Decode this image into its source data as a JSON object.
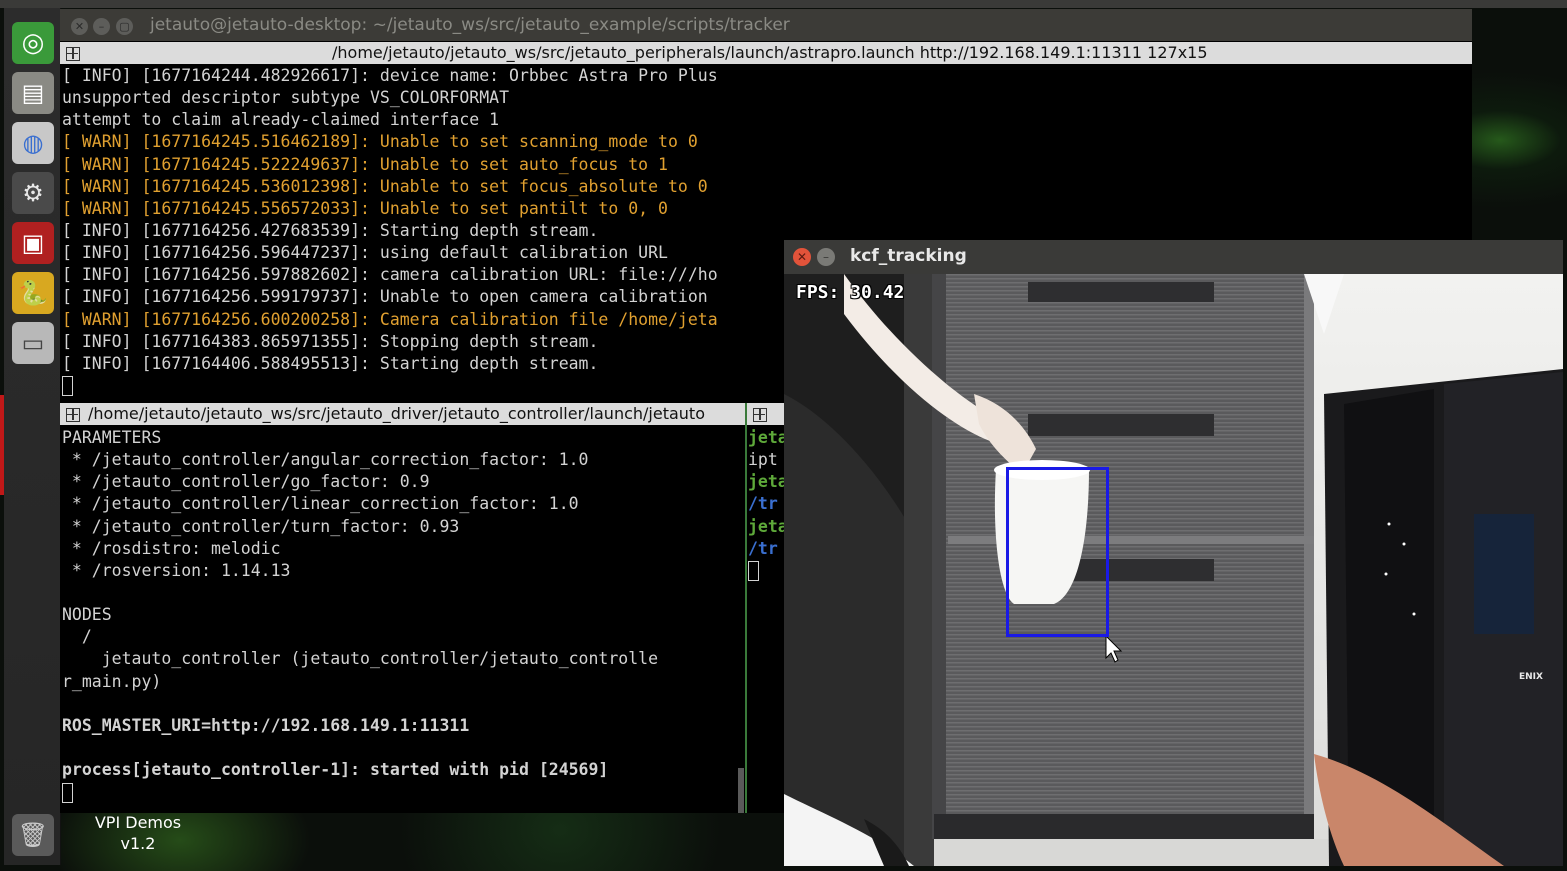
{
  "desktop": {
    "label_title": "VPI Demos",
    "label_version": "v1.2"
  },
  "launcher": {
    "items": [
      {
        "name": "ubuntu-dash",
        "glyph": "◎",
        "color": "#3a9a3a"
      },
      {
        "name": "files",
        "glyph": "▤",
        "color": "#8a8a84"
      },
      {
        "name": "archive-manager",
        "glyph": "◍",
        "color": "#c8c8c8"
      },
      {
        "name": "system-settings",
        "glyph": "⚙",
        "color": "#4a4a4a"
      },
      {
        "name": "monitor-app",
        "glyph": "▣",
        "color": "#b02020"
      },
      {
        "name": "python",
        "glyph": "🐍",
        "color": "#d8a820"
      },
      {
        "name": "drive",
        "glyph": "▭",
        "color": "#b8b8b8"
      },
      {
        "name": "trash",
        "glyph": "🗑",
        "color": "#5a5a5a"
      }
    ]
  },
  "terminal_main": {
    "window_title": "jetauto@jetauto-desktop: ~/jetauto_ws/src/jetauto_example/scripts/tracker",
    "tab_title": "/home/jetauto/jetauto_ws/src/jetauto_peripherals/launch/astrapro.launch http://192.168.149.1:11311 127x15",
    "lines": [
      {
        "text": "[ INFO] [1677164244.482926617]: device name: Orbbec Astra Pro Plus",
        "level": "info"
      },
      {
        "text": "unsupported descriptor subtype VS_COLORFORMAT",
        "level": "info"
      },
      {
        "text": "attempt to claim already-claimed interface 1",
        "level": "info"
      },
      {
        "text": "[ WARN] [1677164245.516462189]: Unable to set scanning_mode to 0",
        "level": "warn"
      },
      {
        "text": "[ WARN] [1677164245.522249637]: Unable to set auto_focus to 1",
        "level": "warn"
      },
      {
        "text": "[ WARN] [1677164245.536012398]: Unable to set focus_absolute to 0",
        "level": "warn"
      },
      {
        "text": "[ WARN] [1677164245.556572033]: Unable to set pantilt to 0, 0",
        "level": "warn"
      },
      {
        "text": "[ INFO] [1677164256.427683539]: Starting depth stream.",
        "level": "info"
      },
      {
        "text": "[ INFO] [1677164256.596447237]: using default calibration URL",
        "level": "info"
      },
      {
        "text": "[ INFO] [1677164256.597882602]: camera calibration URL: file:///ho",
        "level": "info"
      },
      {
        "text": "[ INFO] [1677164256.599179737]: Unable to open camera calibration",
        "level": "info"
      },
      {
        "text": "[ WARN] [1677164256.600200258]: Camera calibration file /home/jeta",
        "level": "warn"
      },
      {
        "text": "[ INFO] [1677164383.865971355]: Stopping depth stream.",
        "level": "info"
      },
      {
        "text": "[ INFO] [1677164406.588495513]: Starting depth stream.",
        "level": "info"
      }
    ]
  },
  "terminal_controller": {
    "tab_title": "/home/jetauto/jetauto_ws/src/jetauto_driver/jetauto_controller/launch/jetauto",
    "lines": [
      {
        "text": "PARAMETERS",
        "style": "normal"
      },
      {
        "text": " * /jetauto_controller/angular_correction_factor: 1.0",
        "style": "normal"
      },
      {
        "text": " * /jetauto_controller/go_factor: 0.9",
        "style": "normal"
      },
      {
        "text": " * /jetauto_controller/linear_correction_factor: 1.0",
        "style": "normal"
      },
      {
        "text": " * /jetauto_controller/turn_factor: 0.93",
        "style": "normal"
      },
      {
        "text": " * /rosdistro: melodic",
        "style": "normal"
      },
      {
        "text": " * /rosversion: 1.14.13",
        "style": "normal"
      },
      {
        "text": "",
        "style": "normal"
      },
      {
        "text": "NODES",
        "style": "normal"
      },
      {
        "text": "  /",
        "style": "normal"
      },
      {
        "text": "    jetauto_controller (jetauto_controller/jetauto_controlle",
        "style": "normal"
      },
      {
        "text": "r_main.py)",
        "style": "normal"
      },
      {
        "text": "",
        "style": "normal"
      },
      {
        "text": "ROS_MASTER_URI=http://192.168.149.1:11311",
        "style": "bold"
      },
      {
        "text": "",
        "style": "normal"
      },
      {
        "text": "process[jetauto_controller-1]: started with pid [24569]",
        "style": "bold"
      }
    ]
  },
  "terminal_small": {
    "lines": [
      {
        "text": "jeta",
        "style": "green"
      },
      {
        "text": "ipt",
        "style": "normal"
      },
      {
        "text": "jeta",
        "style": "green"
      },
      {
        "text": "/tr",
        "style": "blue"
      },
      {
        "text": "jeta",
        "style": "green"
      },
      {
        "text": "/tr",
        "style": "blue"
      }
    ]
  },
  "kcf_window": {
    "title": "kcf_tracking",
    "fps_text": "FPS: 30.42",
    "close_glyph": "✕",
    "min_glyph": "–",
    "case_label": "ENIX"
  }
}
